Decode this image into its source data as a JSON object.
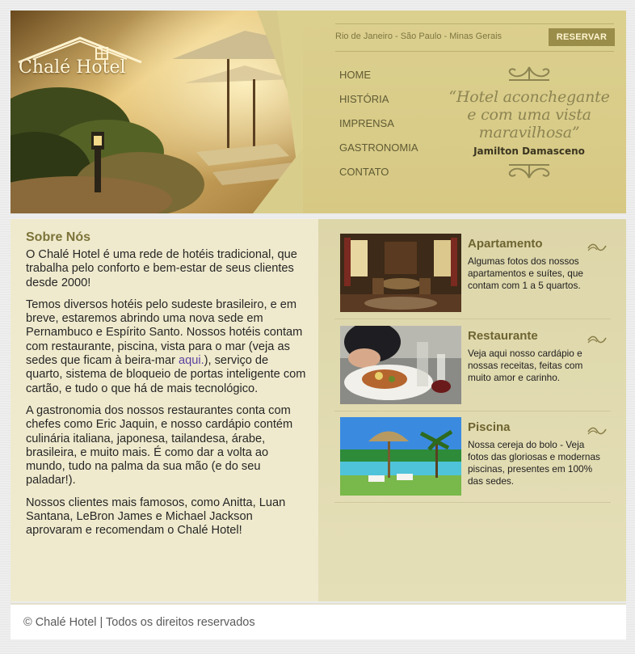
{
  "brand": {
    "name": "Chalé Hotel"
  },
  "header": {
    "cities": "Rio de Janeiro - São Paulo - Minas Gerais",
    "reserve_label": "RESERVAR",
    "nav": [
      "HOME",
      "HISTÓRIA",
      "IMPRENSA",
      "GASTRONOMIA",
      "CONTATO"
    ],
    "quote_lines": [
      "“Hotel aconchegante",
      "e com uma vista",
      "maravilhosa”"
    ],
    "quote_author": "Jamilton Damasceno"
  },
  "about": {
    "title": "Sobre Nós",
    "p1": "O Chalé Hotel é uma rede de hotéis tradicional, que trabalha pelo conforto e bem-estar de seus clientes desde 2000!",
    "p2_before": "Temos diversos hotéis pelo sudeste brasileiro, e em breve, estaremos abrindo uma nova sede em Pernambuco e Espírito Santo. Nossos hotéis contam com restaurante, piscina, vista para o mar (veja as sedes que ficam à beira-mar ",
    "p2_link": "aqui.",
    "p2_after": "), serviço de quarto, sistema de bloqueio de portas inteligente com cartão, e tudo o que há de mais tecnológico.",
    "p3": "A gastronomia dos nossos restaurantes conta com chefes como Eric Jaquin, e nosso cardápio contém culinária italiana, japonesa, tailandesa, árabe, brasileira, e muito mais. É como dar a volta ao mundo, tudo na palma da sua mão (e do seu paladar!).",
    "p4": "Nossos clientes mais famosos, como Anitta, Luan Santana, LeBron James e Michael Jackson aprovaram e recomendam o Chalé Hotel!"
  },
  "cards": [
    {
      "title": "Apartamento",
      "desc": "Algumas fotos dos nossos apartamentos e suítes, que contam com 1 a 5 quartos."
    },
    {
      "title": "Restaurante",
      "desc": "Veja aqui nosso cardápio e nossas receitas, feitas com muito amor e carinho."
    },
    {
      "title": "Piscina",
      "desc": "Nossa cereja do bolo - Veja fotos das gloriosas e modernas piscinas, presentes em 100% das sedes."
    }
  ],
  "footer": {
    "text": "© Chalé Hotel | Todos os direitos reservados"
  },
  "colors": {
    "accent": "#7c7339",
    "header_bg": "#d6c98a",
    "button": "#9a8d4a"
  }
}
